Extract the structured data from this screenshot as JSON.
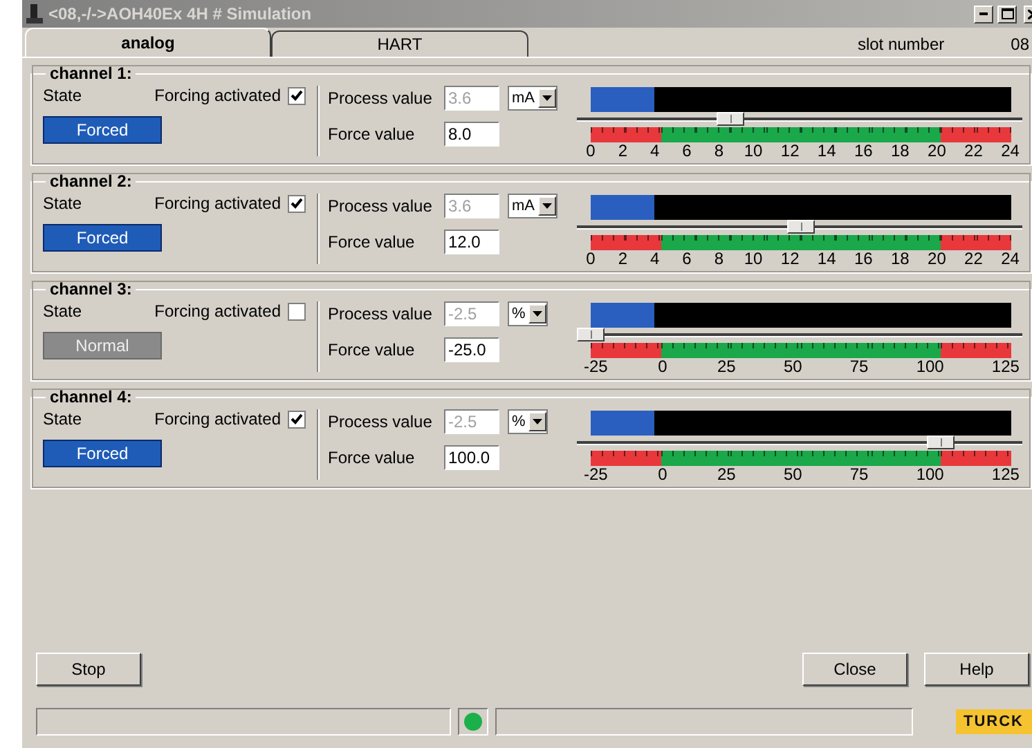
{
  "window": {
    "title": "<08,-/->AOH40Ex 4H # Simulation"
  },
  "tabs": [
    {
      "label": "analog",
      "selected": true
    },
    {
      "label": "HART",
      "selected": false
    }
  ],
  "slot": {
    "label": "slot number",
    "value": "08"
  },
  "channels": [
    {
      "title": "channel 1:",
      "state_label": "State",
      "state": {
        "text": "Forced",
        "forced": true
      },
      "forcing": {
        "label": "Forcing activated",
        "checked": true
      },
      "process_value": {
        "label": "Process value",
        "value": "3.6",
        "unit": "mA",
        "disabled": true
      },
      "force_value": {
        "label": "Force value",
        "value": "8.0"
      },
      "meter": {
        "level": 0.15
      },
      "slider": {
        "level": 0.3333
      },
      "scale": {
        "labels": [
          "0",
          "2",
          "4",
          "6",
          "8",
          "10",
          "12",
          "14",
          "16",
          "18",
          "20",
          "22",
          "24"
        ],
        "segments": [
          {
            "alarm": true
          },
          {
            "alarm": true
          },
          {
            "alarm": false
          },
          {
            "alarm": false
          },
          {
            "alarm": false
          },
          {
            "alarm": false
          },
          {
            "alarm": false
          },
          {
            "alarm": false
          },
          {
            "alarm": false
          },
          {
            "alarm": false
          },
          {
            "alarm": true
          },
          {
            "alarm": true
          }
        ]
      }
    },
    {
      "title": "channel 2:",
      "state_label": "State",
      "state": {
        "text": "Forced",
        "forced": true
      },
      "forcing": {
        "label": "Forcing activated",
        "checked": true
      },
      "process_value": {
        "label": "Process value",
        "value": "3.6",
        "unit": "mA",
        "disabled": true
      },
      "force_value": {
        "label": "Force value",
        "value": "12.0"
      },
      "meter": {
        "level": 0.15
      },
      "slider": {
        "level": 0.5
      },
      "scale": {
        "labels": [
          "0",
          "2",
          "4",
          "6",
          "8",
          "10",
          "12",
          "14",
          "16",
          "18",
          "20",
          "22",
          "24"
        ],
        "segments": [
          {
            "alarm": true
          },
          {
            "alarm": true
          },
          {
            "alarm": false
          },
          {
            "alarm": false
          },
          {
            "alarm": false
          },
          {
            "alarm": false
          },
          {
            "alarm": false
          },
          {
            "alarm": false
          },
          {
            "alarm": false
          },
          {
            "alarm": false
          },
          {
            "alarm": true
          },
          {
            "alarm": true
          }
        ]
      }
    },
    {
      "title": "channel 3:",
      "state_label": "State",
      "state": {
        "text": "Normal",
        "forced": false
      },
      "forcing": {
        "label": "Forcing activated",
        "checked": false
      },
      "process_value": {
        "label": "Process value",
        "value": "-2.5",
        "unit": "%",
        "disabled": true
      },
      "force_value": {
        "label": "Force value",
        "value": "-25.0"
      },
      "meter": {
        "level": 0.15
      },
      "slider": {
        "level": 0
      },
      "scale": {
        "labels": [
          "-25",
          "0",
          "25",
          "50",
          "75",
          "100",
          "125"
        ],
        "segments": [
          {
            "alarm": true
          },
          {
            "alarm": false
          },
          {
            "alarm": false
          },
          {
            "alarm": false
          },
          {
            "alarm": false
          },
          {
            "alarm": true
          }
        ]
      }
    },
    {
      "title": "channel 4:",
      "state_label": "State",
      "state": {
        "text": "Forced",
        "forced": true
      },
      "forcing": {
        "label": "Forcing activated",
        "checked": true
      },
      "process_value": {
        "label": "Process value",
        "value": "-2.5",
        "unit": "%",
        "disabled": true
      },
      "force_value": {
        "label": "Force value",
        "value": "100.0"
      },
      "meter": {
        "level": 0.15
      },
      "slider": {
        "level": 0.8333
      },
      "scale": {
        "labels": [
          "-25",
          "0",
          "25",
          "50",
          "75",
          "100",
          "125"
        ],
        "segments": [
          {
            "alarm": true
          },
          {
            "alarm": false
          },
          {
            "alarm": false
          },
          {
            "alarm": false
          },
          {
            "alarm": false
          },
          {
            "alarm": true
          }
        ]
      }
    }
  ],
  "buttons": {
    "stop": "Stop",
    "close": "Close",
    "help": "Help"
  },
  "status_bar": {
    "led_on": true
  },
  "logo": "TURCK"
}
